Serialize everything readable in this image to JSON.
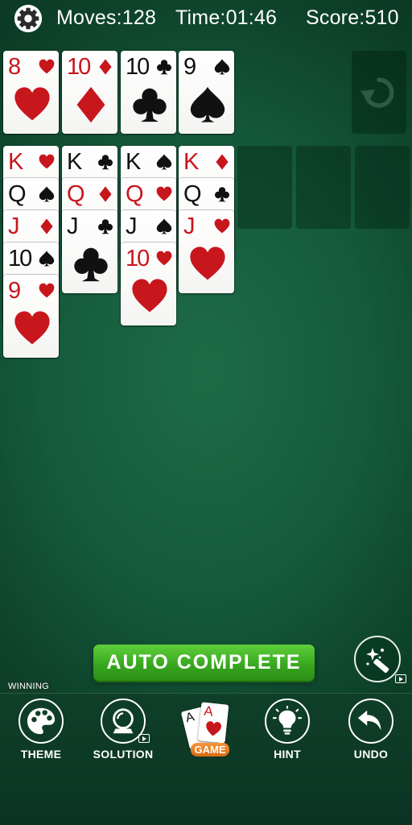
{
  "header": {
    "moves": "Moves:128",
    "time": "Time:01:46",
    "score": "Score:510"
  },
  "foundations": [
    {
      "rank": "8",
      "suit": "heart",
      "color": "red"
    },
    {
      "rank": "10",
      "suit": "diamond",
      "color": "red"
    },
    {
      "rank": "10",
      "suit": "club",
      "color": "black"
    },
    {
      "rank": "9",
      "suit": "spade",
      "color": "black"
    }
  ],
  "tableau": [
    [
      {
        "rank": "K",
        "suit": "heart",
        "color": "red"
      },
      {
        "rank": "Q",
        "suit": "spade",
        "color": "black"
      },
      {
        "rank": "J",
        "suit": "diamond",
        "color": "red"
      },
      {
        "rank": "10",
        "suit": "spade",
        "color": "black"
      },
      {
        "rank": "9",
        "suit": "heart",
        "color": "red"
      }
    ],
    [
      {
        "rank": "K",
        "suit": "club",
        "color": "black"
      },
      {
        "rank": "Q",
        "suit": "diamond",
        "color": "red"
      },
      {
        "rank": "J",
        "suit": "club",
        "color": "black"
      }
    ],
    [
      {
        "rank": "K",
        "suit": "spade",
        "color": "black"
      },
      {
        "rank": "Q",
        "suit": "heart",
        "color": "red"
      },
      {
        "rank": "J",
        "suit": "spade",
        "color": "black"
      },
      {
        "rank": "10",
        "suit": "heart",
        "color": "red"
      }
    ],
    [
      {
        "rank": "K",
        "suit": "diamond",
        "color": "red"
      },
      {
        "rank": "Q",
        "suit": "club",
        "color": "black"
      },
      {
        "rank": "J",
        "suit": "heart",
        "color": "red"
      }
    ],
    [],
    [],
    []
  ],
  "auto_complete_label": "AUTO COMPLETE",
  "winning_label": "WINNING",
  "nav": {
    "theme": "THEME",
    "solution": "SOLUTION",
    "game": "GAME",
    "hint": "HINT",
    "undo": "UNDO"
  },
  "colors": {
    "table_green": "#155a3b",
    "card_red": "#c8161d",
    "auto_button_green": "#36a51e",
    "game_badge_orange": "#e57a20"
  },
  "icons": {
    "settings": "gear-icon",
    "stock": "refresh-icon",
    "magic": "magic-wand-icon",
    "theme": "palette-icon",
    "solution": "crystal-ball-icon",
    "hint": "lightbulb-icon",
    "undo": "undo-arrow-icon"
  }
}
